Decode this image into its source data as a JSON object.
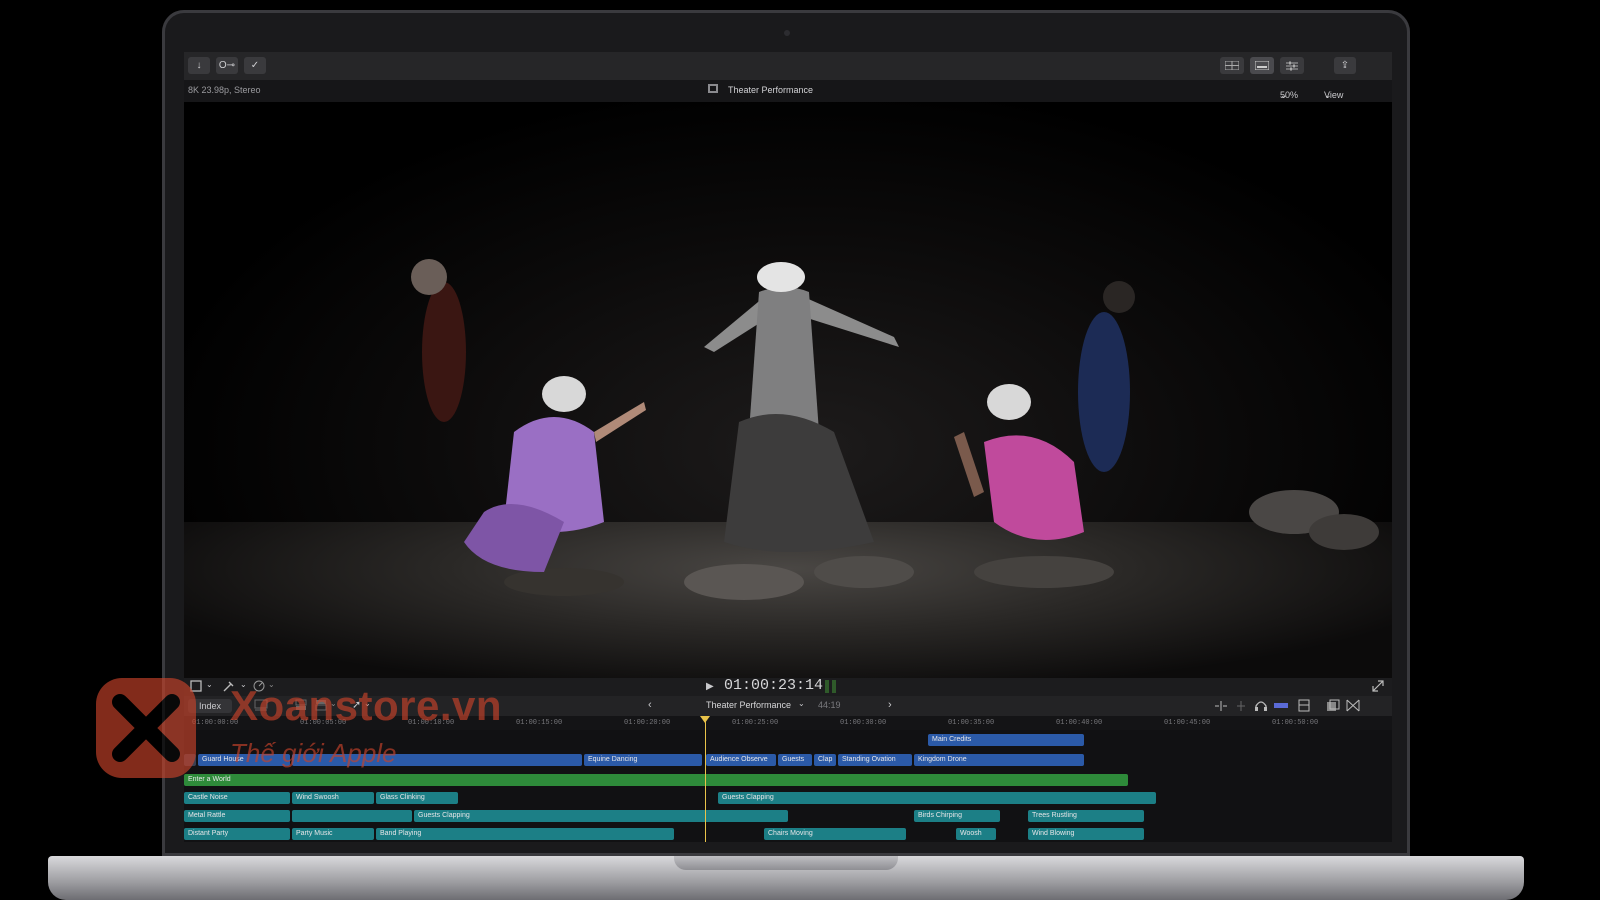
{
  "toolbar": {
    "import_icon": "↓",
    "keyword_label": "O⊸",
    "check_icon": "✓",
    "share_icon": "⇪"
  },
  "infobar": {
    "format": "8K 23.98p, Stereo",
    "project_title": "Theater Performance",
    "zoom": "50%",
    "view_label": "View"
  },
  "viewer_controls": {
    "play_icon": "▶",
    "timecode": "01:00:23:14"
  },
  "timeline_bar": {
    "index_label": "Index",
    "project_name": "Theater Performance",
    "duration": "44:19"
  },
  "ruler": [
    "01:00:00:00",
    "01:00:05:00",
    "01:00:10:00",
    "01:00:15:00",
    "01:00:20:00",
    "01:00:25:00",
    "01:00:30:00",
    "01:00:35:00",
    "01:00:40:00",
    "01:00:45:00",
    "01:00:50:00"
  ],
  "clips": {
    "main_credits": "Main Credits",
    "guard_house": "Guard House",
    "equine_dancing": "Equine Dancing",
    "audience_observe": "Audience Observe",
    "guests": "Guests",
    "clap": "Clap",
    "standing_ovation": "Standing Ovation",
    "kingdom_drone": "Kingdom Drone",
    "enter_world": "Enter a World",
    "castle_noise": "Castle Noise",
    "wind_swoosh": "Wind Swoosh",
    "glass_clinking": "Glass Clinking",
    "guests_clapping_1": "Guests Clapping",
    "metal_rattle": "Metal Rattle",
    "guests_clapping_2": "Guests Clapping",
    "birds_chirping": "Birds Chirping",
    "trees_rustling": "Trees Rustling",
    "distant_party": "Distant Party",
    "party_music": "Party Music",
    "band_playing": "Band Playing",
    "chairs_moving": "Chairs Moving",
    "woosh": "Woosh",
    "wind_blowing": "Wind Blowing"
  },
  "watermark": {
    "brand": "Xoanstore.vn",
    "tagline": "Thế giới Apple"
  }
}
